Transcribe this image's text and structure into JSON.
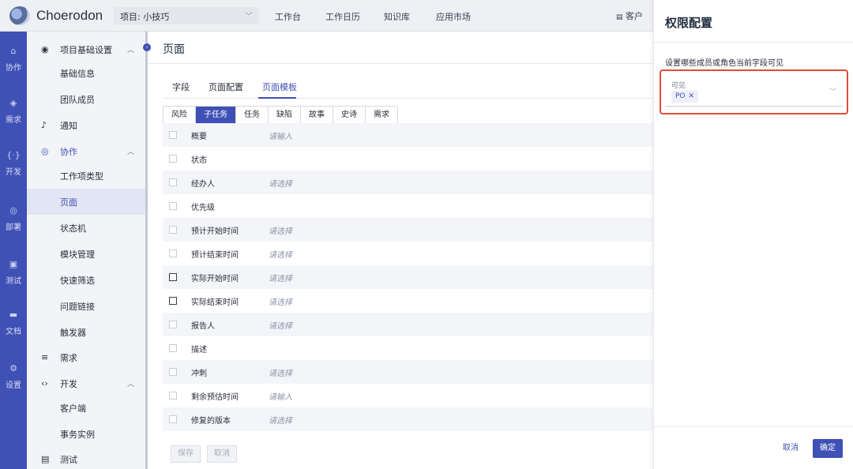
{
  "app": {
    "name": "Choerodon"
  },
  "header": {
    "project": "项目: 小技巧",
    "nav": [
      "工作台",
      "工作日历",
      "知识库",
      "应用市场"
    ],
    "client_tab": "客户"
  },
  "rail": [
    "协作",
    "需求",
    "开发",
    "部署",
    "测试",
    "文档",
    "设置"
  ],
  "menu": {
    "project_settings": "项目基础设置",
    "basic_info": "基础信息",
    "team_members": "团队成员",
    "notify": "通知",
    "collab": "协作",
    "issue_types": "工作项类型",
    "page": "页面",
    "state_machine": "状态机",
    "module_mgmt": "模块管理",
    "quick_filter": "快速筛选",
    "issue_link": "问题链接",
    "trigger": "触发器",
    "demand": "需求",
    "dev": "开发",
    "client": "客户端",
    "tx_instance": "事务实例",
    "test": "测试"
  },
  "page": {
    "title": "页面",
    "tabs": [
      "字段",
      "页面配置",
      "页面模板"
    ],
    "active_tab": "页面模板",
    "subtabs": [
      "风险",
      "子任务",
      "任务",
      "缺陷",
      "故事",
      "史诗",
      "需求"
    ],
    "active_subtab": "子任务",
    "rows": [
      {
        "name": "概要",
        "value": "请输入"
      },
      {
        "name": "状态",
        "value": ""
      },
      {
        "name": "经办人",
        "value": "请选择"
      },
      {
        "name": "优先级",
        "value": ""
      },
      {
        "name": "预计开始时间",
        "value": "请选择"
      },
      {
        "name": "预计结束时间",
        "value": "请选择"
      },
      {
        "name": "实际开始时间",
        "value": "请选择"
      },
      {
        "name": "实际结束时间",
        "value": "请选择"
      },
      {
        "name": "报告人",
        "value": "请选择"
      },
      {
        "name": "描述",
        "value": ""
      },
      {
        "name": "冲刺",
        "value": "请选择"
      },
      {
        "name": "剩余预估时间",
        "value": "请输入"
      },
      {
        "name": "修复的版本",
        "value": "请选择"
      }
    ],
    "save": "保存",
    "cancel": "取消"
  },
  "modal": {
    "title": "权限配置",
    "desc": "设置哪些成员或角色当前字段可见",
    "select_label": "可见",
    "tag": "PO",
    "cancel": "取消",
    "ok": "确定"
  },
  "colors": {
    "primary": "#3f51b5",
    "highlight": "#e4493b"
  }
}
